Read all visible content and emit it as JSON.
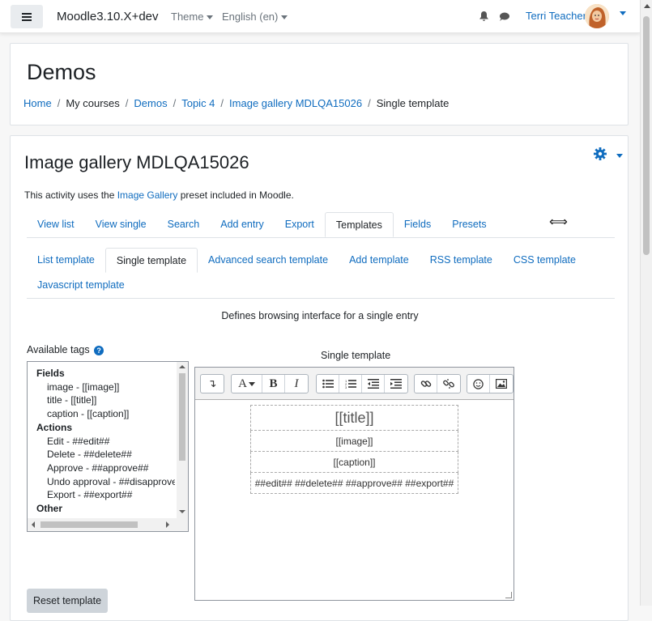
{
  "navbar": {
    "brand": "Moodle3.10.X+dev",
    "theme_menu": "Theme",
    "language_menu": "English (en)",
    "user_name": "Terri Teacher"
  },
  "header": {
    "title": "Demos",
    "breadcrumb": [
      "Home",
      "My courses",
      "Demos",
      "Topic 4",
      "Image gallery MDLQA15026",
      "Single template"
    ]
  },
  "activity": {
    "title": "Image gallery MDLQA15026",
    "intro_before": "This activity uses the ",
    "intro_link": "Image Gallery",
    "intro_after": " preset included in Moodle."
  },
  "tabs": [
    "View list",
    "View single",
    "Search",
    "Add entry",
    "Export",
    "Templates",
    "Fields",
    "Presets"
  ],
  "active_tab": "Templates",
  "subtabs": [
    "List template",
    "Single template",
    "Advanced search template",
    "Add template",
    "RSS template",
    "CSS template",
    "Javascript template"
  ],
  "active_subtab": "Single template",
  "description": "Defines browsing interface for a single entry",
  "available_tags": {
    "label": "Available tags",
    "groups": [
      {
        "name": "Fields",
        "items": [
          "image - [[image]]",
          "title - [[title]]",
          "caption - [[caption]]"
        ]
      },
      {
        "name": "Actions",
        "items": [
          "Edit - ##edit##",
          "Delete - ##delete##",
          "Approve - ##approve##",
          "Undo approval - ##disapprove##",
          "Export - ##export##"
        ]
      },
      {
        "name": "Other",
        "items": []
      }
    ]
  },
  "editor": {
    "label": "Single template",
    "toolbar_icons": [
      "collapse-icon",
      "font-color-icon",
      "bold-icon",
      "italic-icon",
      "unordered-list-icon",
      "ordered-list-icon",
      "outdent-icon",
      "indent-icon",
      "link-icon",
      "unlink-icon",
      "emoji-icon",
      "image-icon"
    ],
    "content": [
      "[[title]]",
      "[[image]]",
      "[[caption]]",
      "##edit## ##delete## ##approve## ##export##"
    ]
  },
  "buttons": {
    "reset": "Reset template"
  }
}
